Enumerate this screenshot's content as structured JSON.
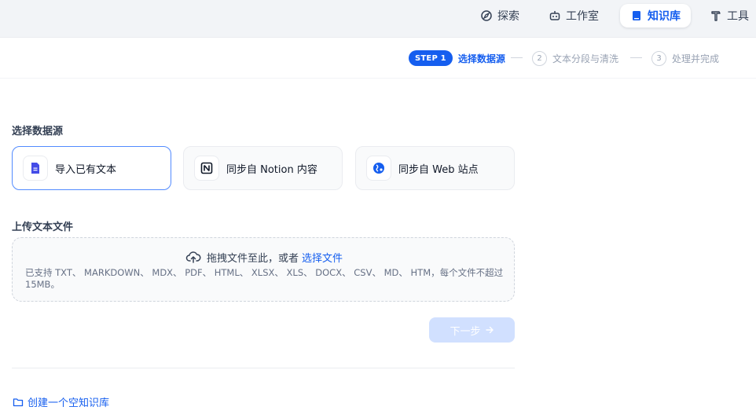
{
  "nav": {
    "items": [
      {
        "label": "探索",
        "icon": "compass-icon"
      },
      {
        "label": "工作室",
        "icon": "robot-icon"
      },
      {
        "label": "知识库",
        "icon": "book-icon",
        "active": true
      },
      {
        "label": "工具",
        "icon": "hammer-icon"
      }
    ]
  },
  "steps": {
    "badge": "STEP 1",
    "step1_label": "选择数据源",
    "step2_num": "2",
    "step2_label": "文本分段与清洗",
    "step3_num": "3",
    "step3_label": "处理并完成"
  },
  "datasource": {
    "title": "选择数据源",
    "options": [
      {
        "label": "导入已有文本",
        "icon": "file-text-icon",
        "selected": true
      },
      {
        "label": "同步自 Notion 内容",
        "icon": "notion-icon"
      },
      {
        "label": "同步自 Web 站点",
        "icon": "web-globe-icon"
      }
    ]
  },
  "upload": {
    "title": "上传文本文件",
    "drag_text": "拖拽文件至此，或者",
    "select_link": "选择文件",
    "hint": "已支持 TXT、 MARKDOWN、 MDX、 PDF、 HTML、 XLSX、 XLS、 DOCX、 CSV、 MD、 HTM，每个文件不超过 15MB。"
  },
  "actions": {
    "next_label": "下一步",
    "create_empty": "创建一个空知识库"
  },
  "colors": {
    "accent": "#155eef",
    "disabled_button": "#d1e0ff"
  }
}
